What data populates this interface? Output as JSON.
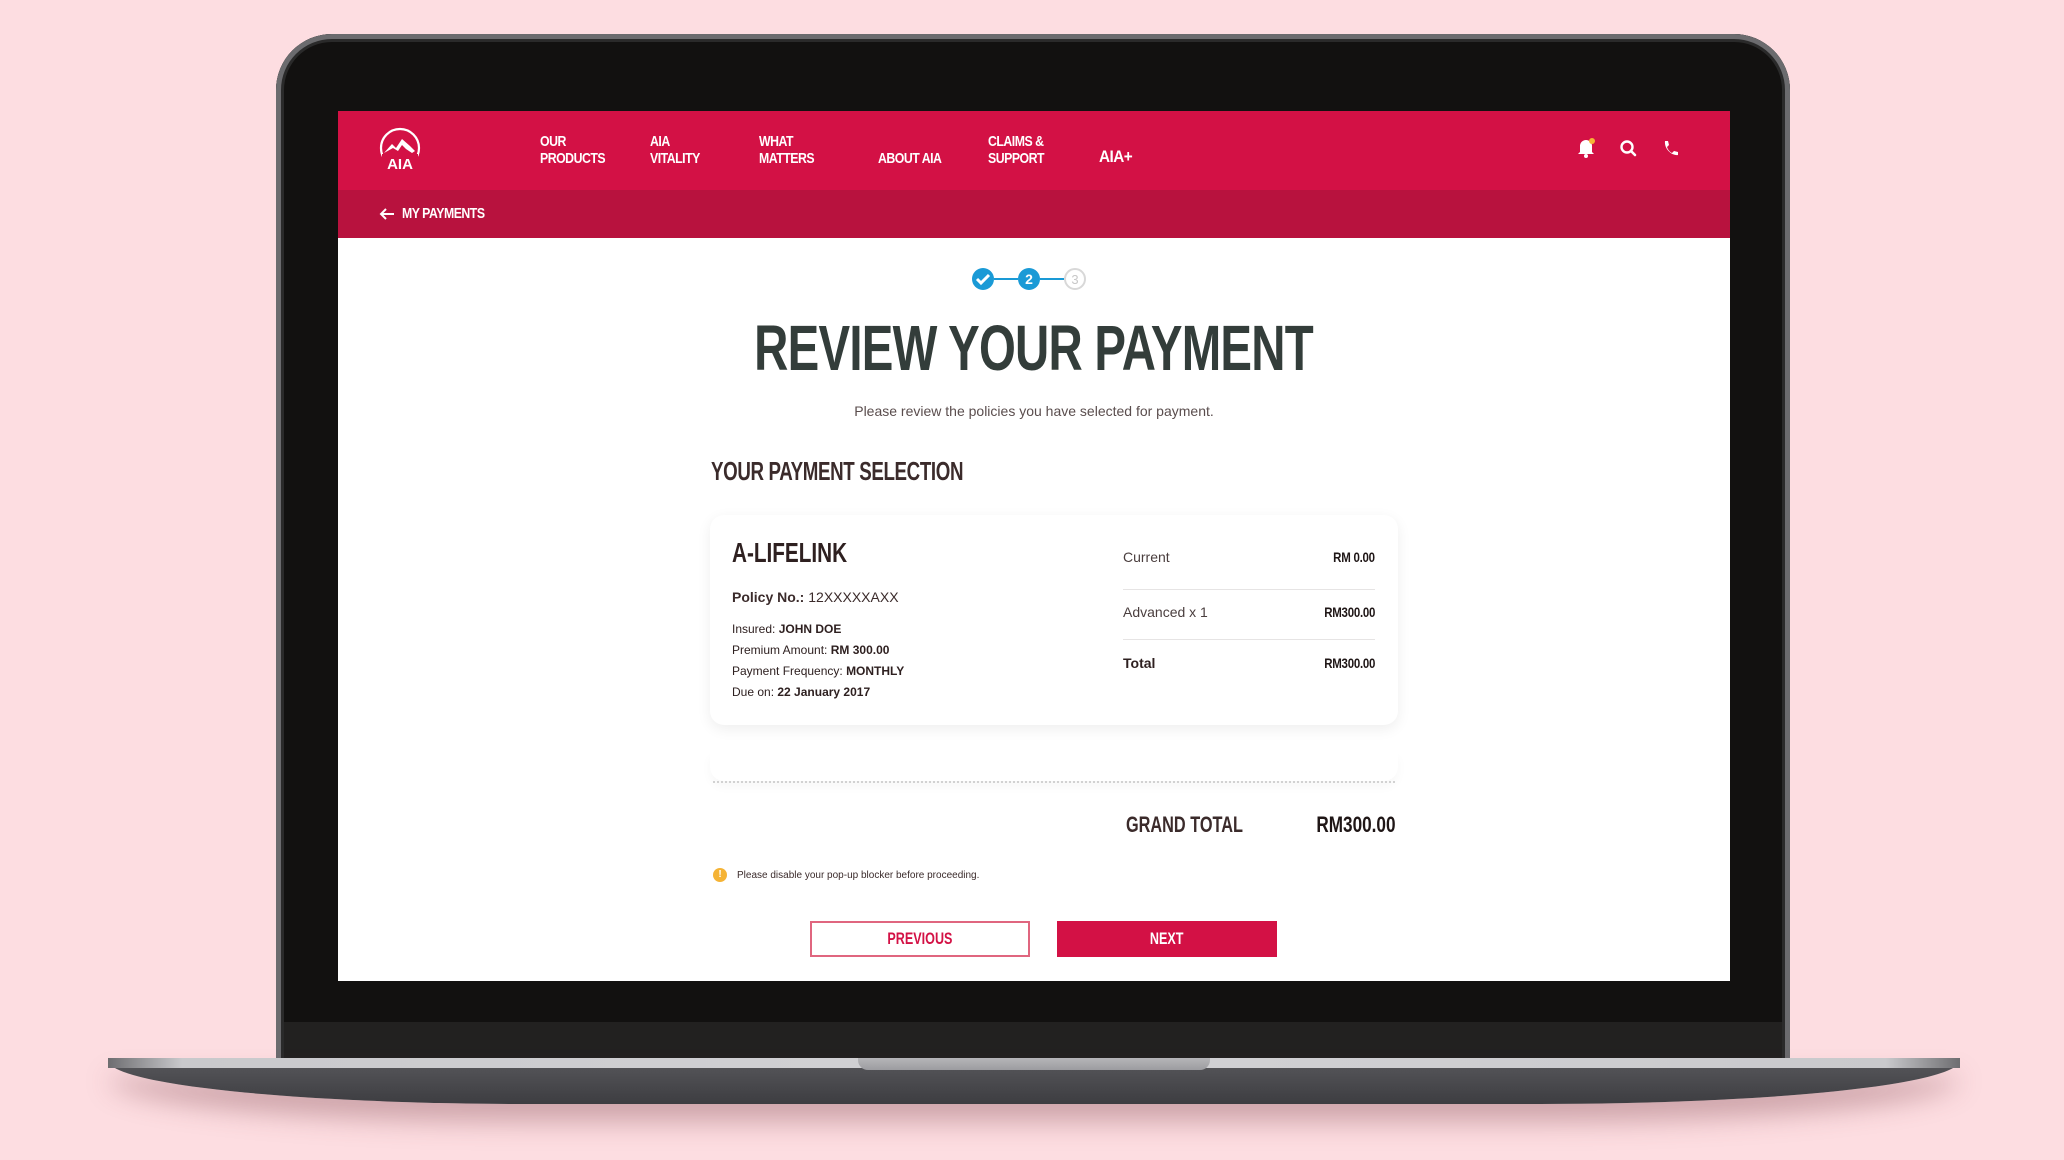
{
  "colors": {
    "brand_red": "#d31145",
    "subnav_red": "#b8123e",
    "step_blue": "#1a9ad6",
    "warning_amber": "#f5b335",
    "background_pink": "#fddde1"
  },
  "nav": {
    "logo": "AIA",
    "items": [
      {
        "label": "OUR\nPRODUCTS"
      },
      {
        "label": "AIA\nVITALITY"
      },
      {
        "label": "WHAT\nMATTERS"
      },
      {
        "label": "ABOUT AIA"
      },
      {
        "label": "CLAIMS &\nSUPPORT"
      },
      {
        "label": "AIA+"
      }
    ],
    "icons": [
      "bell-icon",
      "search-icon",
      "phone-icon"
    ]
  },
  "subnav": {
    "back_label": "MY PAYMENTS"
  },
  "steps": {
    "items": [
      {
        "label": "✓",
        "state": "done"
      },
      {
        "label": "2",
        "state": "current"
      },
      {
        "label": "3",
        "state": "upcoming"
      }
    ]
  },
  "page": {
    "title": "REVIEW YOUR PAYMENT",
    "subtitle": "Please review the policies you have selected for payment.",
    "section_title": "YOUR PAYMENT SELECTION"
  },
  "policy": {
    "name": "A-LIFELINK",
    "policy_no_label": "Policy No.:",
    "policy_no": "12XXXXXAXX",
    "insured_label": "Insured:",
    "insured": "JOHN DOE",
    "premium_label": "Premium Amount:",
    "premium": "RM 300.00",
    "frequency_label": "Payment Frequency:",
    "frequency": "MONTHLY",
    "due_label": "Due on:",
    "due": "22 January 2017",
    "summary": [
      {
        "label": "Current",
        "value": "RM 0.00"
      },
      {
        "label": "Advanced x 1",
        "value": "RM300.00"
      },
      {
        "label": "Total",
        "value": "RM300.00"
      }
    ]
  },
  "grand_total": {
    "label": "GRAND TOTAL",
    "value": "RM300.00"
  },
  "warning": {
    "icon": "!",
    "text": "Please disable your pop-up blocker before proceeding."
  },
  "buttons": {
    "previous": "PREVIOUS",
    "next": "NEXT"
  }
}
